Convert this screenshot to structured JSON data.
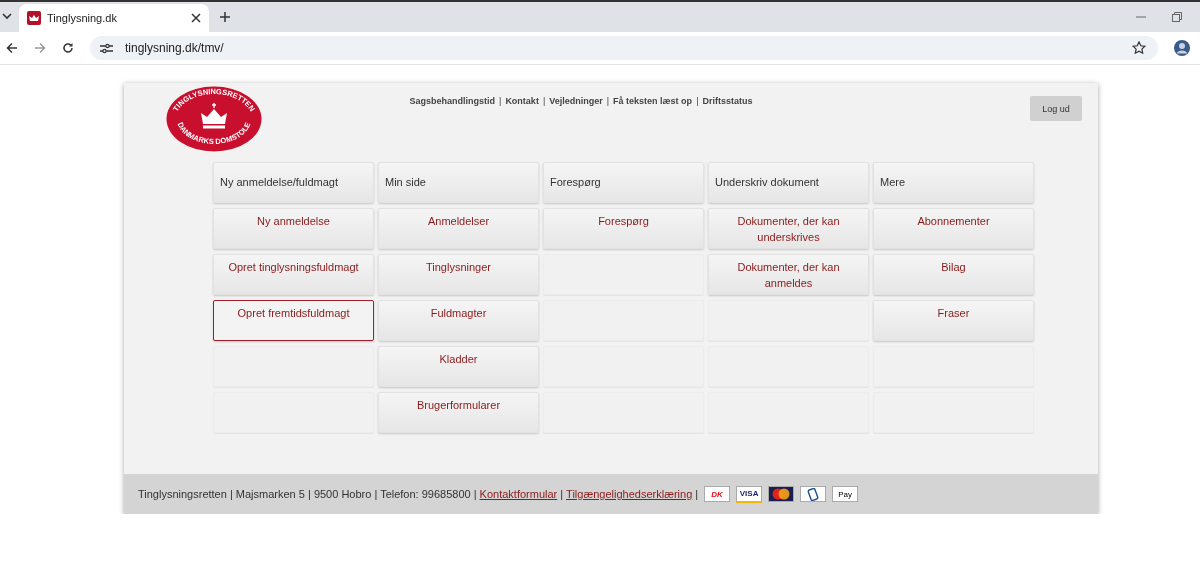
{
  "browser": {
    "tabs": [
      {
        "title": "Tinglysning.dk",
        "selected": true
      }
    ],
    "url": "tinglysning.dk/tmv/"
  },
  "header": {
    "logo": {
      "top_text": "TINGLYSNINGSRETTEN",
      "bottom_text": "DANMARKS DOMSTOLE"
    },
    "nav": [
      {
        "kind": "link",
        "text": "Sagsbehandlingstid"
      },
      {
        "kind": "sep",
        "text": "|"
      },
      {
        "kind": "link",
        "text": "Kontakt"
      },
      {
        "kind": "sep",
        "text": "|"
      },
      {
        "kind": "link",
        "text": "Vejledninger"
      },
      {
        "kind": "sep",
        "text": "|"
      },
      {
        "kind": "link",
        "text": "Få teksten læst op"
      },
      {
        "kind": "sep",
        "text": "|"
      },
      {
        "kind": "link",
        "text": "Driftsstatus"
      }
    ],
    "logout": "Log ud"
  },
  "menu": {
    "columns": [
      {
        "header": "Ny anmeldelse/fuldmagt",
        "items": [
          {
            "label": "Ny anmeldelse",
            "selected": false
          },
          {
            "label": "Opret tinglysningsfuldmagt",
            "selected": false
          },
          {
            "label": "Opret fremtidsfuldmagt",
            "selected": true
          }
        ]
      },
      {
        "header": "Min side",
        "items": [
          {
            "label": "Anmeldelser",
            "selected": false
          },
          {
            "label": "Tinglysninger",
            "selected": false
          },
          {
            "label": "Fuldmagter",
            "selected": false
          },
          {
            "label": "Kladder",
            "selected": false
          },
          {
            "label": "Brugerformularer",
            "selected": false
          }
        ]
      },
      {
        "header": "Forespørg",
        "items": [
          {
            "label": "Forespørg",
            "selected": false
          }
        ]
      },
      {
        "header": "Underskriv dokument",
        "items": [
          {
            "label": "Dokumenter, der kan underskrives",
            "selected": false
          },
          {
            "label": "Dokumenter, der kan anmeldes",
            "selected": false
          }
        ]
      },
      {
        "header": "Mere",
        "items": [
          {
            "label": "Abonnementer",
            "selected": false
          },
          {
            "label": "Bilag",
            "selected": false
          },
          {
            "label": "Fraser",
            "selected": false
          }
        ]
      }
    ]
  },
  "footer": {
    "parts": [
      {
        "kind": "text",
        "text": "Tinglysningsretten | Majsmarken 5 | 9500 Hobro | Telefon: 99685800 |"
      },
      {
        "kind": "link",
        "text": "Kontaktformular"
      },
      {
        "kind": "text",
        "text": "|"
      },
      {
        "kind": "link",
        "text": "Tilgængelighedserklæring"
      },
      {
        "kind": "text",
        "text": "|"
      }
    ],
    "cards": [
      {
        "kind": "dankort",
        "label": "DK"
      },
      {
        "kind": "visa",
        "label": "VISA"
      },
      {
        "kind": "mastercard"
      },
      {
        "kind": "mobilepay"
      },
      {
        "kind": "applepay",
        "label": "Pay"
      }
    ]
  }
}
